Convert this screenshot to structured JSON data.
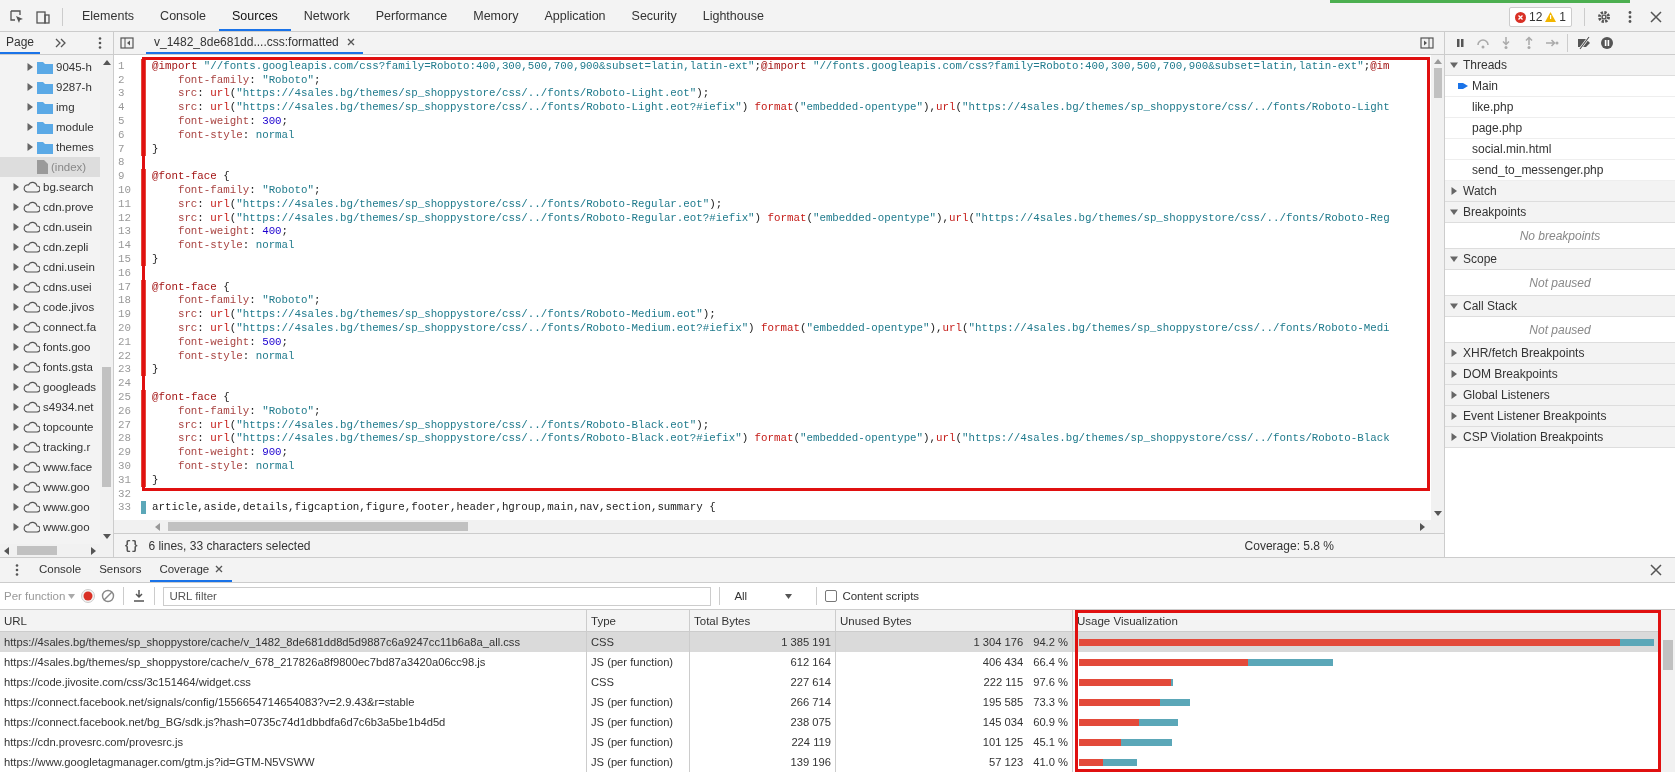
{
  "main_toolbar": {
    "tabs": [
      {
        "label": "Elements",
        "selected": false
      },
      {
        "label": "Console",
        "selected": false
      },
      {
        "label": "Sources",
        "selected": true
      },
      {
        "label": "Network",
        "selected": false
      },
      {
        "label": "Performance",
        "selected": false
      },
      {
        "label": "Memory",
        "selected": false
      },
      {
        "label": "Application",
        "selected": false
      },
      {
        "label": "Security",
        "selected": false
      },
      {
        "label": "Lighthouse",
        "selected": false
      }
    ],
    "errors": "12",
    "warnings": "1"
  },
  "navigator": {
    "tabs": [
      {
        "label": "Page",
        "selected": true
      }
    ],
    "tree": [
      {
        "children": [
          {
            "kind": "folder",
            "label": "9045-h",
            "expanded": false,
            "selected": false
          },
          {
            "kind": "folder",
            "label": "9287-h",
            "expanded": false,
            "selected": false
          },
          {
            "kind": "folder",
            "label": "img",
            "expanded": false,
            "selected": false
          },
          {
            "kind": "folder",
            "label": "module",
            "expanded": false,
            "selected": false
          },
          {
            "kind": "folder",
            "label": "themes",
            "expanded": false,
            "selected": false
          },
          {
            "kind": "file",
            "label": "(index)",
            "selected": true
          }
        ]
      },
      {
        "kind": "domain",
        "label": "bg.search",
        "expanded": false,
        "selected": false
      },
      {
        "kind": "domain",
        "label": "cdn.prove",
        "expanded": false,
        "selected": false
      },
      {
        "kind": "domain",
        "label": "cdn.usein",
        "expanded": false,
        "selected": false
      },
      {
        "kind": "domain",
        "label": "cdn.zepli",
        "expanded": false,
        "selected": false
      },
      {
        "kind": "domain",
        "label": "cdni.usein",
        "expanded": false,
        "selected": false
      },
      {
        "kind": "domain",
        "label": "cdns.usei",
        "expanded": false,
        "selected": false
      },
      {
        "kind": "domain",
        "label": "code.jivos",
        "expanded": false,
        "selected": false
      },
      {
        "kind": "domain",
        "label": "connect.fa",
        "expanded": false,
        "selected": false
      },
      {
        "kind": "domain",
        "label": "fonts.goo",
        "expanded": false,
        "selected": false
      },
      {
        "kind": "domain",
        "label": "fonts.gsta",
        "expanded": false,
        "selected": false
      },
      {
        "kind": "domain",
        "label": "googleads",
        "expanded": false,
        "selected": false
      },
      {
        "kind": "domain",
        "label": "s4934.net",
        "expanded": false,
        "selected": false
      },
      {
        "kind": "domain",
        "label": "topcounte",
        "expanded": false,
        "selected": false
      },
      {
        "kind": "domain",
        "label": "tracking.r",
        "expanded": false,
        "selected": false
      },
      {
        "kind": "domain",
        "label": "www.face",
        "expanded": false,
        "selected": false
      },
      {
        "kind": "domain",
        "label": "www.goo",
        "expanded": false,
        "selected": false
      },
      {
        "kind": "domain",
        "label": "www.goo",
        "expanded": false,
        "selected": false
      },
      {
        "kind": "domain",
        "label": "www.goo",
        "expanded": false,
        "selected": false
      }
    ]
  },
  "editor": {
    "tab": {
      "label": "v_1482_8de681dd....css:formatted",
      "closable": true
    },
    "highlighted": true,
    "lines": [
      {
        "number": "1",
        "kind": "unused",
        "indented": false,
        "tokens": [
          {
            "kind": "at",
            "text": "@import"
          },
          {
            "kind": "string",
            "text": " \"//fonts.googleapis.com/css?family=Roboto:400,300,500,700,900&subset=latin,latin-ext\""
          },
          {
            "kind": "plain",
            "text": ";"
          },
          {
            "kind": "at",
            "text": "@import"
          },
          {
            "kind": "string",
            "text": " \"//fonts.googleapis.com/css?family=Roboto:400,300,500,700,900&subset=latin,latin-ext\""
          },
          {
            "kind": "plain",
            "text": ";"
          },
          {
            "kind": "at",
            "text": "@im"
          }
        ]
      },
      {
        "number": "2",
        "kind": "unused",
        "indented": true,
        "tokens": [
          {
            "kind": "property",
            "text": "font-family"
          },
          {
            "kind": "plain",
            "text": ":"
          },
          {
            "kind": "string",
            "text": " \"Roboto\""
          },
          {
            "kind": "plain",
            "text": ";"
          }
        ]
      },
      {
        "number": "3",
        "kind": "unused",
        "indented": true,
        "tokens": [
          {
            "kind": "property",
            "text": "src"
          },
          {
            "kind": "plain",
            "text": ":"
          },
          {
            "kind": "function",
            "text": " url"
          },
          {
            "kind": "plain",
            "text": "("
          },
          {
            "kind": "string",
            "text": "\"https://4sales.bg/themes/sp_shoppystore/css/../fonts/Roboto-Light.eot\""
          },
          {
            "kind": "plain",
            "text": ");"
          }
        ]
      },
      {
        "number": "4",
        "kind": "unused",
        "indented": true,
        "tokens": [
          {
            "kind": "property",
            "text": "src"
          },
          {
            "kind": "plain",
            "text": ":"
          },
          {
            "kind": "function",
            "text": " url"
          },
          {
            "kind": "plain",
            "text": "("
          },
          {
            "kind": "string",
            "text": "\"https://4sales.bg/themes/sp_shoppystore/css/../fonts/Roboto-Light.eot?#iefix\""
          },
          {
            "kind": "plain",
            "text": ")"
          },
          {
            "kind": "function",
            "text": " format"
          },
          {
            "kind": "plain",
            "text": "("
          },
          {
            "kind": "string",
            "text": "\"embedded-opentype\""
          },
          {
            "kind": "plain",
            "text": "),"
          },
          {
            "kind": "function",
            "text": "url"
          },
          {
            "kind": "plain",
            "text": "("
          },
          {
            "kind": "string",
            "text": "\"https://4sales.bg/themes/sp_shoppystore/css/../fonts/Roboto-Light"
          }
        ]
      },
      {
        "number": "5",
        "kind": "unused",
        "indented": true,
        "tokens": [
          {
            "kind": "property",
            "text": "font-weight"
          },
          {
            "kind": "plain",
            "text": ":"
          },
          {
            "kind": "number",
            "text": " 300"
          },
          {
            "kind": "plain",
            "text": ";"
          }
        ]
      },
      {
        "number": "6",
        "kind": "unused",
        "indented": true,
        "tokens": [
          {
            "kind": "property",
            "text": "font-style"
          },
          {
            "kind": "plain",
            "text": ":"
          },
          {
            "kind": "keyword",
            "text": " normal"
          }
        ]
      },
      {
        "number": "7",
        "kind": "unused",
        "indented": false,
        "tokens": [
          {
            "kind": "plain",
            "text": "}"
          }
        ]
      },
      {
        "number": "8",
        "kind": "blank"
      },
      {
        "number": "9",
        "kind": "unused",
        "indented": false,
        "tokens": [
          {
            "kind": "at",
            "text": "@font-face"
          },
          {
            "kind": "plain",
            "text": " {"
          }
        ]
      },
      {
        "number": "10",
        "kind": "unused",
        "indented": true,
        "tokens": [
          {
            "kind": "property",
            "text": "font-family"
          },
          {
            "kind": "plain",
            "text": ":"
          },
          {
            "kind": "string",
            "text": " \"Roboto\""
          },
          {
            "kind": "plain",
            "text": ";"
          }
        ]
      },
      {
        "number": "11",
        "kind": "unused",
        "indented": true,
        "tokens": [
          {
            "kind": "property",
            "text": "src"
          },
          {
            "kind": "plain",
            "text": ":"
          },
          {
            "kind": "function",
            "text": " url"
          },
          {
            "kind": "plain",
            "text": "("
          },
          {
            "kind": "string",
            "text": "\"https://4sales.bg/themes/sp_shoppystore/css/../fonts/Roboto-Regular.eot\""
          },
          {
            "kind": "plain",
            "text": ");"
          }
        ]
      },
      {
        "number": "12",
        "kind": "unused",
        "indented": true,
        "tokens": [
          {
            "kind": "property",
            "text": "src"
          },
          {
            "kind": "plain",
            "text": ":"
          },
          {
            "kind": "function",
            "text": " url"
          },
          {
            "kind": "plain",
            "text": "("
          },
          {
            "kind": "string",
            "text": "\"https://4sales.bg/themes/sp_shoppystore/css/../fonts/Roboto-Regular.eot?#iefix\""
          },
          {
            "kind": "plain",
            "text": ")"
          },
          {
            "kind": "function",
            "text": " format"
          },
          {
            "kind": "plain",
            "text": "("
          },
          {
            "kind": "string",
            "text": "\"embedded-opentype\""
          },
          {
            "kind": "plain",
            "text": "),"
          },
          {
            "kind": "function",
            "text": "url"
          },
          {
            "kind": "plain",
            "text": "("
          },
          {
            "kind": "string",
            "text": "\"https://4sales.bg/themes/sp_shoppystore/css/../fonts/Roboto-Reg"
          }
        ]
      },
      {
        "number": "13",
        "kind": "unused",
        "indented": true,
        "tokens": [
          {
            "kind": "property",
            "text": "font-weight"
          },
          {
            "kind": "plain",
            "text": ":"
          },
          {
            "kind": "number",
            "text": " 400"
          },
          {
            "kind": "plain",
            "text": ";"
          }
        ]
      },
      {
        "number": "14",
        "kind": "unused",
        "indented": true,
        "tokens": [
          {
            "kind": "property",
            "text": "font-style"
          },
          {
            "kind": "plain",
            "text": ":"
          },
          {
            "kind": "keyword",
            "text": " normal"
          }
        ]
      },
      {
        "number": "15",
        "kind": "unused",
        "indented": false,
        "tokens": [
          {
            "kind": "plain",
            "text": "}"
          }
        ]
      },
      {
        "number": "16",
        "kind": "blank"
      },
      {
        "number": "17",
        "kind": "unused",
        "indented": false,
        "tokens": [
          {
            "kind": "at",
            "text": "@font-face"
          },
          {
            "kind": "plain",
            "text": " {"
          }
        ]
      },
      {
        "number": "18",
        "kind": "unused",
        "indented": true,
        "tokens": [
          {
            "kind": "property",
            "text": "font-family"
          },
          {
            "kind": "plain",
            "text": ":"
          },
          {
            "kind": "string",
            "text": " \"Roboto\""
          },
          {
            "kind": "plain",
            "text": ";"
          }
        ]
      },
      {
        "number": "19",
        "kind": "unused",
        "indented": true,
        "tokens": [
          {
            "kind": "property",
            "text": "src"
          },
          {
            "kind": "plain",
            "text": ":"
          },
          {
            "kind": "function",
            "text": " url"
          },
          {
            "kind": "plain",
            "text": "("
          },
          {
            "kind": "string",
            "text": "\"https://4sales.bg/themes/sp_shoppystore/css/../fonts/Roboto-Medium.eot\""
          },
          {
            "kind": "plain",
            "text": ");"
          }
        ]
      },
      {
        "number": "20",
        "kind": "unused",
        "indented": true,
        "tokens": [
          {
            "kind": "property",
            "text": "src"
          },
          {
            "kind": "plain",
            "text": ":"
          },
          {
            "kind": "function",
            "text": " url"
          },
          {
            "kind": "plain",
            "text": "("
          },
          {
            "kind": "string",
            "text": "\"https://4sales.bg/themes/sp_shoppystore/css/../fonts/Roboto-Medium.eot?#iefix\""
          },
          {
            "kind": "plain",
            "text": ")"
          },
          {
            "kind": "function",
            "text": " format"
          },
          {
            "kind": "plain",
            "text": "("
          },
          {
            "kind": "string",
            "text": "\"embedded-opentype\""
          },
          {
            "kind": "plain",
            "text": "),"
          },
          {
            "kind": "function",
            "text": "url"
          },
          {
            "kind": "plain",
            "text": "("
          },
          {
            "kind": "string",
            "text": "\"https://4sales.bg/themes/sp_shoppystore/css/../fonts/Roboto-Medi"
          }
        ]
      },
      {
        "number": "21",
        "kind": "unused",
        "indented": true,
        "tokens": [
          {
            "kind": "property",
            "text": "font-weight"
          },
          {
            "kind": "plain",
            "text": ":"
          },
          {
            "kind": "number",
            "text": " 500"
          },
          {
            "kind": "plain",
            "text": ";"
          }
        ]
      },
      {
        "number": "22",
        "kind": "unused",
        "indented": true,
        "tokens": [
          {
            "kind": "property",
            "text": "font-style"
          },
          {
            "kind": "plain",
            "text": ":"
          },
          {
            "kind": "keyword",
            "text": " normal"
          }
        ]
      },
      {
        "number": "23",
        "kind": "unused",
        "indented": false,
        "tokens": [
          {
            "kind": "plain",
            "text": "}"
          }
        ]
      },
      {
        "number": "24",
        "kind": "blank"
      },
      {
        "number": "25",
        "kind": "unused",
        "indented": false,
        "tokens": [
          {
            "kind": "at",
            "text": "@font-face"
          },
          {
            "kind": "plain",
            "text": " {"
          }
        ]
      },
      {
        "number": "26",
        "kind": "unused",
        "indented": true,
        "tokens": [
          {
            "kind": "property",
            "text": "font-family"
          },
          {
            "kind": "plain",
            "text": ":"
          },
          {
            "kind": "string",
            "text": " \"Roboto\""
          },
          {
            "kind": "plain",
            "text": ";"
          }
        ]
      },
      {
        "number": "27",
        "kind": "unused",
        "indented": true,
        "tokens": [
          {
            "kind": "property",
            "text": "src"
          },
          {
            "kind": "plain",
            "text": ":"
          },
          {
            "kind": "function",
            "text": " url"
          },
          {
            "kind": "plain",
            "text": "("
          },
          {
            "kind": "string",
            "text": "\"https://4sales.bg/themes/sp_shoppystore/css/../fonts/Roboto-Black.eot\""
          },
          {
            "kind": "plain",
            "text": ");"
          }
        ]
      },
      {
        "number": "28",
        "kind": "unused",
        "indented": true,
        "tokens": [
          {
            "kind": "property",
            "text": "src"
          },
          {
            "kind": "plain",
            "text": ":"
          },
          {
            "kind": "function",
            "text": " url"
          },
          {
            "kind": "plain",
            "text": "("
          },
          {
            "kind": "string",
            "text": "\"https://4sales.bg/themes/sp_shoppystore/css/../fonts/Roboto-Black.eot?#iefix\""
          },
          {
            "kind": "plain",
            "text": ")"
          },
          {
            "kind": "function",
            "text": " format"
          },
          {
            "kind": "plain",
            "text": "("
          },
          {
            "kind": "string",
            "text": "\"embedded-opentype\""
          },
          {
            "kind": "plain",
            "text": "),"
          },
          {
            "kind": "function",
            "text": "url"
          },
          {
            "kind": "plain",
            "text": "("
          },
          {
            "kind": "string",
            "text": "\"https://4sales.bg/themes/sp_shoppystore/css/../fonts/Roboto-Black"
          }
        ]
      },
      {
        "number": "29",
        "kind": "unused",
        "indented": true,
        "tokens": [
          {
            "kind": "property",
            "text": "font-weight"
          },
          {
            "kind": "plain",
            "text": ":"
          },
          {
            "kind": "number",
            "text": " 900"
          },
          {
            "kind": "plain",
            "text": ";"
          }
        ]
      },
      {
        "number": "30",
        "kind": "unused",
        "indented": true,
        "tokens": [
          {
            "kind": "property",
            "text": "font-style"
          },
          {
            "kind": "plain",
            "text": ":"
          },
          {
            "kind": "keyword",
            "text": " normal"
          }
        ]
      },
      {
        "number": "31",
        "kind": "unused",
        "indented": false,
        "tokens": [
          {
            "kind": "plain",
            "text": "}"
          }
        ]
      },
      {
        "number": "32",
        "kind": "blank"
      },
      {
        "number": "33",
        "kind": "used",
        "indented": false,
        "tokens": [
          {
            "kind": "plain",
            "text": "article,aside,details,figcaption,figure,footer,header,hgroup,main,nav,section,summary {"
          }
        ]
      }
    ]
  },
  "status_bar": {
    "format_button": "{}",
    "selection": "6 lines, 33 characters selected",
    "coverage": "Coverage: 5.8 %"
  },
  "debugger": {
    "sections": [
      {
        "title": "Threads",
        "expanded": true,
        "items": [
          {
            "label": "Main",
            "selected": true
          },
          {
            "label": "like.php",
            "selected": false
          },
          {
            "label": "page.php",
            "selected": false
          },
          {
            "label": "social.min.html",
            "selected": false
          },
          {
            "label": "send_to_messenger.php",
            "selected": false
          }
        ]
      },
      {
        "title": "Watch",
        "expanded": false
      },
      {
        "title": "Breakpoints",
        "expanded": true,
        "message": "No breakpoints"
      },
      {
        "title": "Scope",
        "expanded": true,
        "message": "Not paused"
      },
      {
        "title": "Call Stack",
        "expanded": true,
        "message": "Not paused"
      },
      {
        "title": "XHR/fetch Breakpoints",
        "expanded": false
      },
      {
        "title": "DOM Breakpoints",
        "expanded": false
      },
      {
        "title": "Global Listeners",
        "expanded": false
      },
      {
        "title": "Event Listener Breakpoints",
        "expanded": false
      },
      {
        "title": "CSP Violation Breakpoints",
        "expanded": false
      }
    ]
  },
  "drawer": {
    "tabs": [
      {
        "label": "Console",
        "selected": false,
        "closable": false
      },
      {
        "label": "Sensors",
        "selected": false,
        "closable": false
      },
      {
        "label": "Coverage",
        "selected": true,
        "closable": true
      }
    ]
  },
  "coverage": {
    "mode": {
      "label": "Per function",
      "disabled": true
    },
    "recording": true,
    "filter": {
      "placeholder": "URL filter"
    },
    "type_filter": "All",
    "content_scripts": {
      "label": "Content scripts",
      "checked": false
    },
    "table": {
      "usage_highlighted": true,
      "columns": [
        "URL",
        "Type",
        "Total Bytes",
        "Unused Bytes",
        "Usage Visualization"
      ],
      "rows": [
        {
          "url": "https://4sales.bg/themes/sp_shoppystore/cache/v_1482_8de681dd8d5d9887c6a9247cc11b6a8a_all.css",
          "type": "CSS",
          "total": "1 385 191",
          "unused": "1 304 176",
          "percent": "94.2 %",
          "selected": true,
          "unused_share": {
            "level": 0.9415
          }
        },
        {
          "url": "https://4sales.bg/themes/sp_shoppystore/cache/v_678_217826a8f9800ec7bd87a3420a06cc98.js",
          "type": "JS (per function)",
          "total": "612 164",
          "unused": "406 434",
          "percent": "66.4 %",
          "selected": false,
          "unused_share": {
            "level": 0.6639
          }
        },
        {
          "url": "https://code.jivosite.com/css/3c151464/widget.css",
          "type": "CSS",
          "total": "227 614",
          "unused": "222 115",
          "percent": "97.6 %",
          "selected": false,
          "unused_share": {
            "level": 0.9758
          }
        },
        {
          "url": "https://connect.facebook.net/signals/config/1556654714654083?v=2.9.43&r=stable",
          "type": "JS (per function)",
          "total": "266 714",
          "unused": "195 585",
          "percent": "73.3 %",
          "selected": false,
          "unused_share": {
            "level": 0.7333
          }
        },
        {
          "url": "https://connect.facebook.net/bg_BG/sdk.js?hash=0735c74d1dbbdfa6d7c6b3a5be1b4d5d",
          "type": "JS (per function)",
          "total": "238 075",
          "unused": "145 034",
          "percent": "60.9 %",
          "selected": false,
          "unused_share": {
            "level": 0.6092
          }
        },
        {
          "url": "https://cdn.provesrc.com/provesrc.js",
          "type": "JS (per function)",
          "total": "224 119",
          "unused": "101 125",
          "percent": "45.1 %",
          "selected": false,
          "unused_share": {
            "level": 0.4512
          }
        },
        {
          "url": "https://www.googletagmanager.com/gtm.js?id=GTM-N5VSWW",
          "type": "JS (per function)",
          "total": "139 196",
          "unused": "57 123",
          "percent": "41.0 %",
          "selected": false,
          "unused_share": {
            "level": 0.4104
          }
        }
      ]
    }
  }
}
